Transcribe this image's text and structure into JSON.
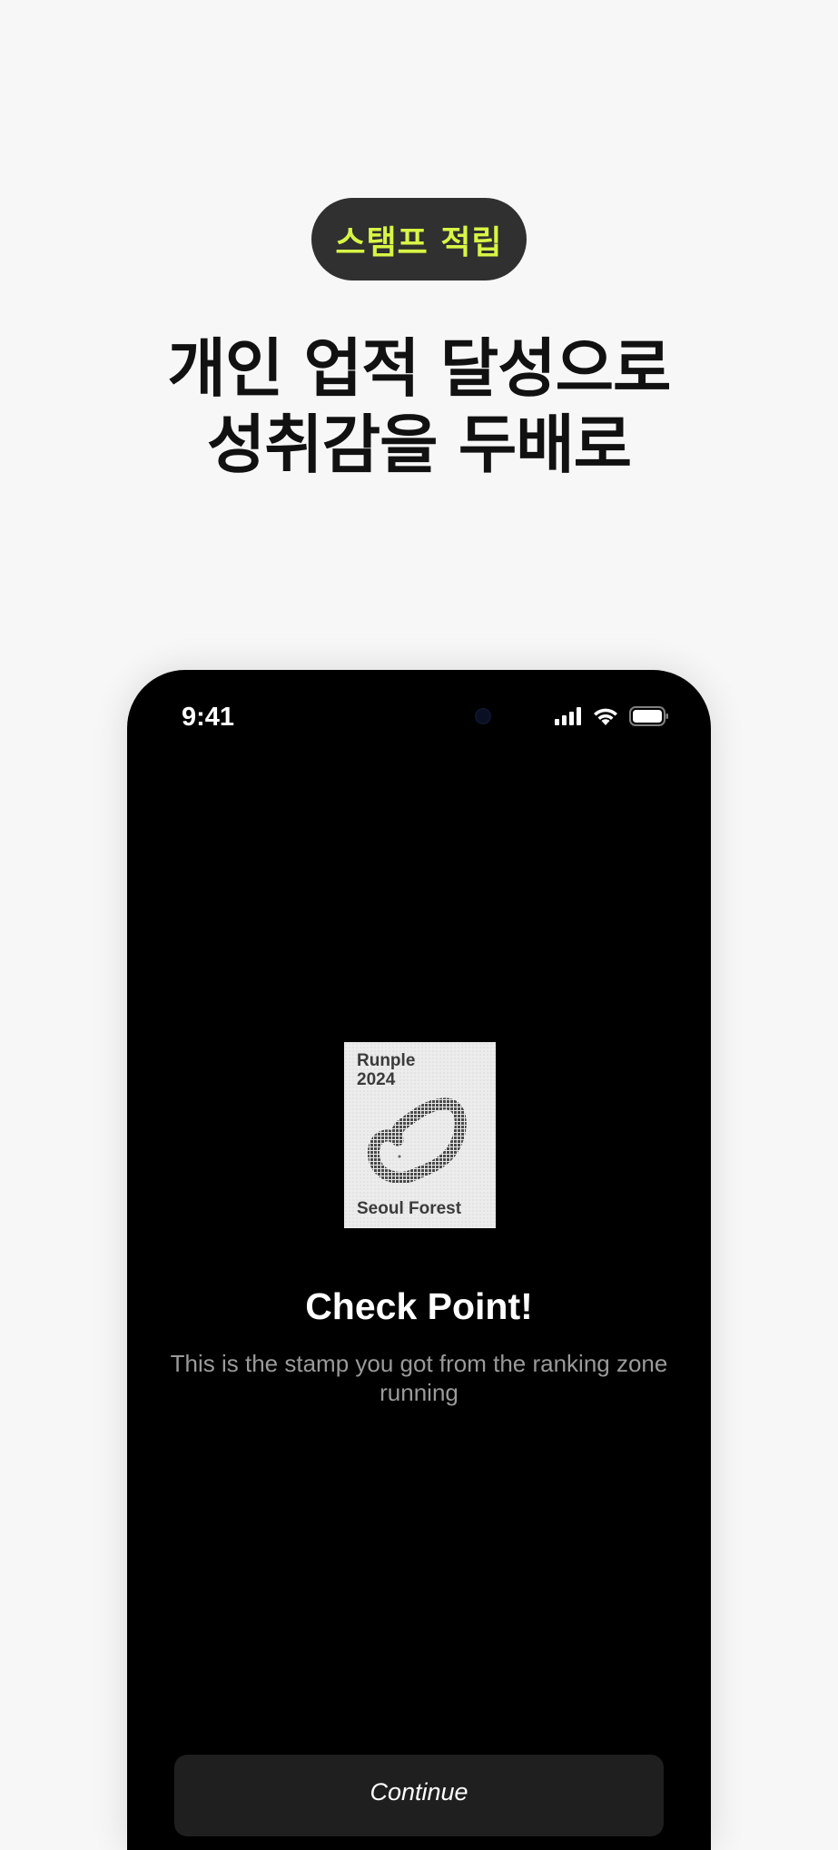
{
  "badge": {
    "label": "스탬프 적립",
    "text_color": "#d8f545",
    "background": "#2f302f"
  },
  "headline": {
    "line1": "개인 업적 달성으로",
    "line2": "성취감을 두배로"
  },
  "phone": {
    "status_bar": {
      "time": "9:41",
      "icons": [
        "signal-icon",
        "wifi-icon",
        "battery-icon"
      ]
    },
    "stamp": {
      "brand": "Runple",
      "year": "2024",
      "location": "Seoul Forest"
    },
    "title": "Check Point!",
    "description": "This is the stamp you got from the ranking zone running",
    "continue_label": "Continue"
  }
}
